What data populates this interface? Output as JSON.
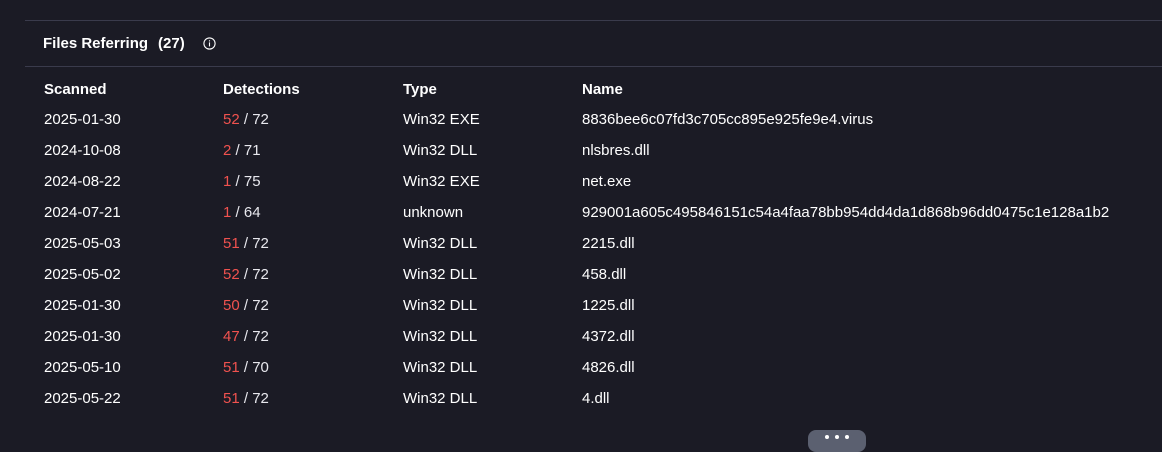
{
  "panel": {
    "title": "Files Referring",
    "count": "(27)"
  },
  "columns": {
    "scanned": "Scanned",
    "detections": "Detections",
    "type": "Type",
    "name": "Name"
  },
  "rows": [
    {
      "scanned": "2025-01-30",
      "positives": "52",
      "total": " / 72",
      "type": "Win32 EXE",
      "name": "8836bee6c07fd3c705cc895e925fe9e4.virus"
    },
    {
      "scanned": "2024-10-08",
      "positives": "2",
      "total": " / 71",
      "type": "Win32 DLL",
      "name": "nlsbres.dll"
    },
    {
      "scanned": "2024-08-22",
      "positives": "1",
      "total": " / 75",
      "type": "Win32 EXE",
      "name": "net.exe"
    },
    {
      "scanned": "2024-07-21",
      "positives": "1",
      "total": " / 64",
      "type": "unknown",
      "name": "929001a605c495846151c54a4faa78bb954dd4da1d868b96dd0475c1e128a1b2"
    },
    {
      "scanned": "2025-05-03",
      "positives": "51",
      "total": " / 72",
      "type": "Win32 DLL",
      "name": "2215.dll"
    },
    {
      "scanned": "2025-05-02",
      "positives": "52",
      "total": " / 72",
      "type": "Win32 DLL",
      "name": "458.dll"
    },
    {
      "scanned": "2025-01-30",
      "positives": "50",
      "total": " / 72",
      "type": "Win32 DLL",
      "name": "1225.dll"
    },
    {
      "scanned": "2025-01-30",
      "positives": "47",
      "total": " / 72",
      "type": "Win32 DLL",
      "name": "4372.dll"
    },
    {
      "scanned": "2025-05-10",
      "positives": "51",
      "total": " / 70",
      "type": "Win32 DLL",
      "name": "4826.dll"
    },
    {
      "scanned": "2025-05-22",
      "positives": "51",
      "total": " / 72",
      "type": "Win32 DLL",
      "name": "4.dll"
    }
  ],
  "icons": {
    "info": "info-icon",
    "more": "more-dots-icon"
  },
  "colors": {
    "background": "#1b1b25",
    "divider": "#3a3b4c",
    "detection_positive": "#f0524f",
    "more_button": "#5b6070"
  }
}
